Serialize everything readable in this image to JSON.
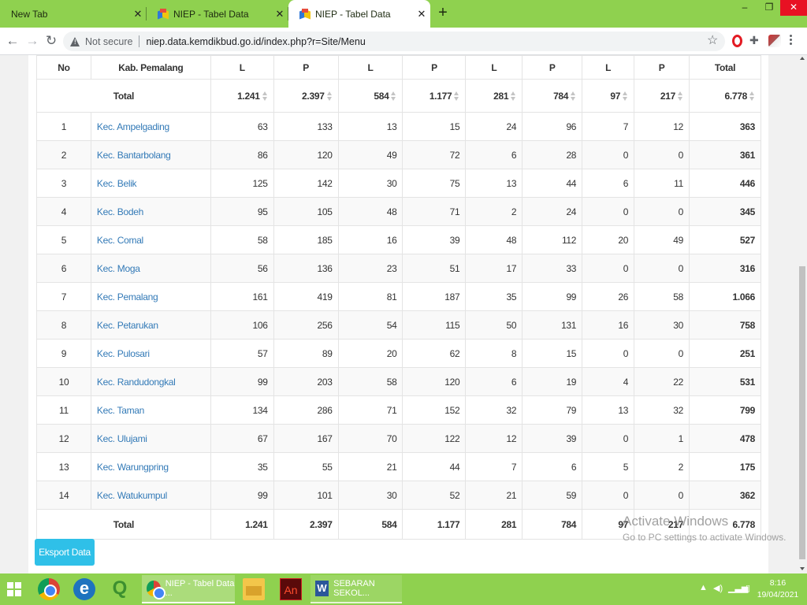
{
  "browser": {
    "tabs": [
      {
        "title": "New Tab",
        "active": false
      },
      {
        "title": "NIEP - Tabel Data",
        "active": false
      },
      {
        "title": "NIEP - Tabel Data",
        "active": true
      }
    ],
    "security_label": "Not secure",
    "url": "niep.data.kemdikbud.go.id/index.php?r=Site/Menu"
  },
  "table": {
    "headers": [
      "No",
      "Kab. Pemalang",
      "L",
      "P",
      "L",
      "P",
      "L",
      "P",
      "L",
      "P",
      "Total"
    ],
    "total_label": "Total",
    "totals": [
      "1.241",
      "2.397",
      "584",
      "1.177",
      "281",
      "784",
      "97",
      "217",
      "6.778"
    ],
    "rows": [
      {
        "no": "1",
        "name": "Kec. Ampelgading",
        "values": [
          "63",
          "133",
          "13",
          "15",
          "24",
          "96",
          "7",
          "12"
        ],
        "total": "363"
      },
      {
        "no": "2",
        "name": "Kec. Bantarbolang",
        "values": [
          "86",
          "120",
          "49",
          "72",
          "6",
          "28",
          "0",
          "0"
        ],
        "total": "361"
      },
      {
        "no": "3",
        "name": "Kec. Belik",
        "values": [
          "125",
          "142",
          "30",
          "75",
          "13",
          "44",
          "6",
          "11"
        ],
        "total": "446"
      },
      {
        "no": "4",
        "name": "Kec. Bodeh",
        "values": [
          "95",
          "105",
          "48",
          "71",
          "2",
          "24",
          "0",
          "0"
        ],
        "total": "345"
      },
      {
        "no": "5",
        "name": "Kec. Comal",
        "values": [
          "58",
          "185",
          "16",
          "39",
          "48",
          "112",
          "20",
          "49"
        ],
        "total": "527"
      },
      {
        "no": "6",
        "name": "Kec. Moga",
        "values": [
          "56",
          "136",
          "23",
          "51",
          "17",
          "33",
          "0",
          "0"
        ],
        "total": "316"
      },
      {
        "no": "7",
        "name": "Kec. Pemalang",
        "values": [
          "161",
          "419",
          "81",
          "187",
          "35",
          "99",
          "26",
          "58"
        ],
        "total": "1.066"
      },
      {
        "no": "8",
        "name": "Kec. Petarukan",
        "values": [
          "106",
          "256",
          "54",
          "115",
          "50",
          "131",
          "16",
          "30"
        ],
        "total": "758"
      },
      {
        "no": "9",
        "name": "Kec. Pulosari",
        "values": [
          "57",
          "89",
          "20",
          "62",
          "8",
          "15",
          "0",
          "0"
        ],
        "total": "251"
      },
      {
        "no": "10",
        "name": "Kec. Randudongkal",
        "values": [
          "99",
          "203",
          "58",
          "120",
          "6",
          "19",
          "4",
          "22"
        ],
        "total": "531"
      },
      {
        "no": "11",
        "name": "Kec. Taman",
        "values": [
          "134",
          "286",
          "71",
          "152",
          "32",
          "79",
          "13",
          "32"
        ],
        "total": "799"
      },
      {
        "no": "12",
        "name": "Kec. Ulujami",
        "values": [
          "67",
          "167",
          "70",
          "122",
          "12",
          "39",
          "0",
          "1"
        ],
        "total": "478"
      },
      {
        "no": "13",
        "name": "Kec. Warungpring",
        "values": [
          "35",
          "55",
          "21",
          "44",
          "7",
          "6",
          "5",
          "2"
        ],
        "total": "175"
      },
      {
        "no": "14",
        "name": "Kec. Watukumpul",
        "values": [
          "99",
          "101",
          "30",
          "52",
          "21",
          "59",
          "0",
          "0"
        ],
        "total": "362"
      }
    ],
    "footer_label": "Total",
    "footer_totals": [
      "1.241",
      "2.397",
      "584",
      "1.177",
      "281",
      "784",
      "97",
      "217",
      "6.778"
    ]
  },
  "export_label": "Eksport Data",
  "watermark": {
    "line1": "Activate Windows",
    "line2": "Go to PC settings to activate Windows."
  },
  "taskbar": {
    "tasks": [
      "NIEP - Tabel Data ...",
      "SEBARAN SEKOL..."
    ],
    "time": "8:16",
    "date": "19/04/2021"
  },
  "colors": {
    "accent_green": "#8fd14f",
    "link_blue": "#337ab7",
    "button_cyan": "#2fc0e8"
  }
}
